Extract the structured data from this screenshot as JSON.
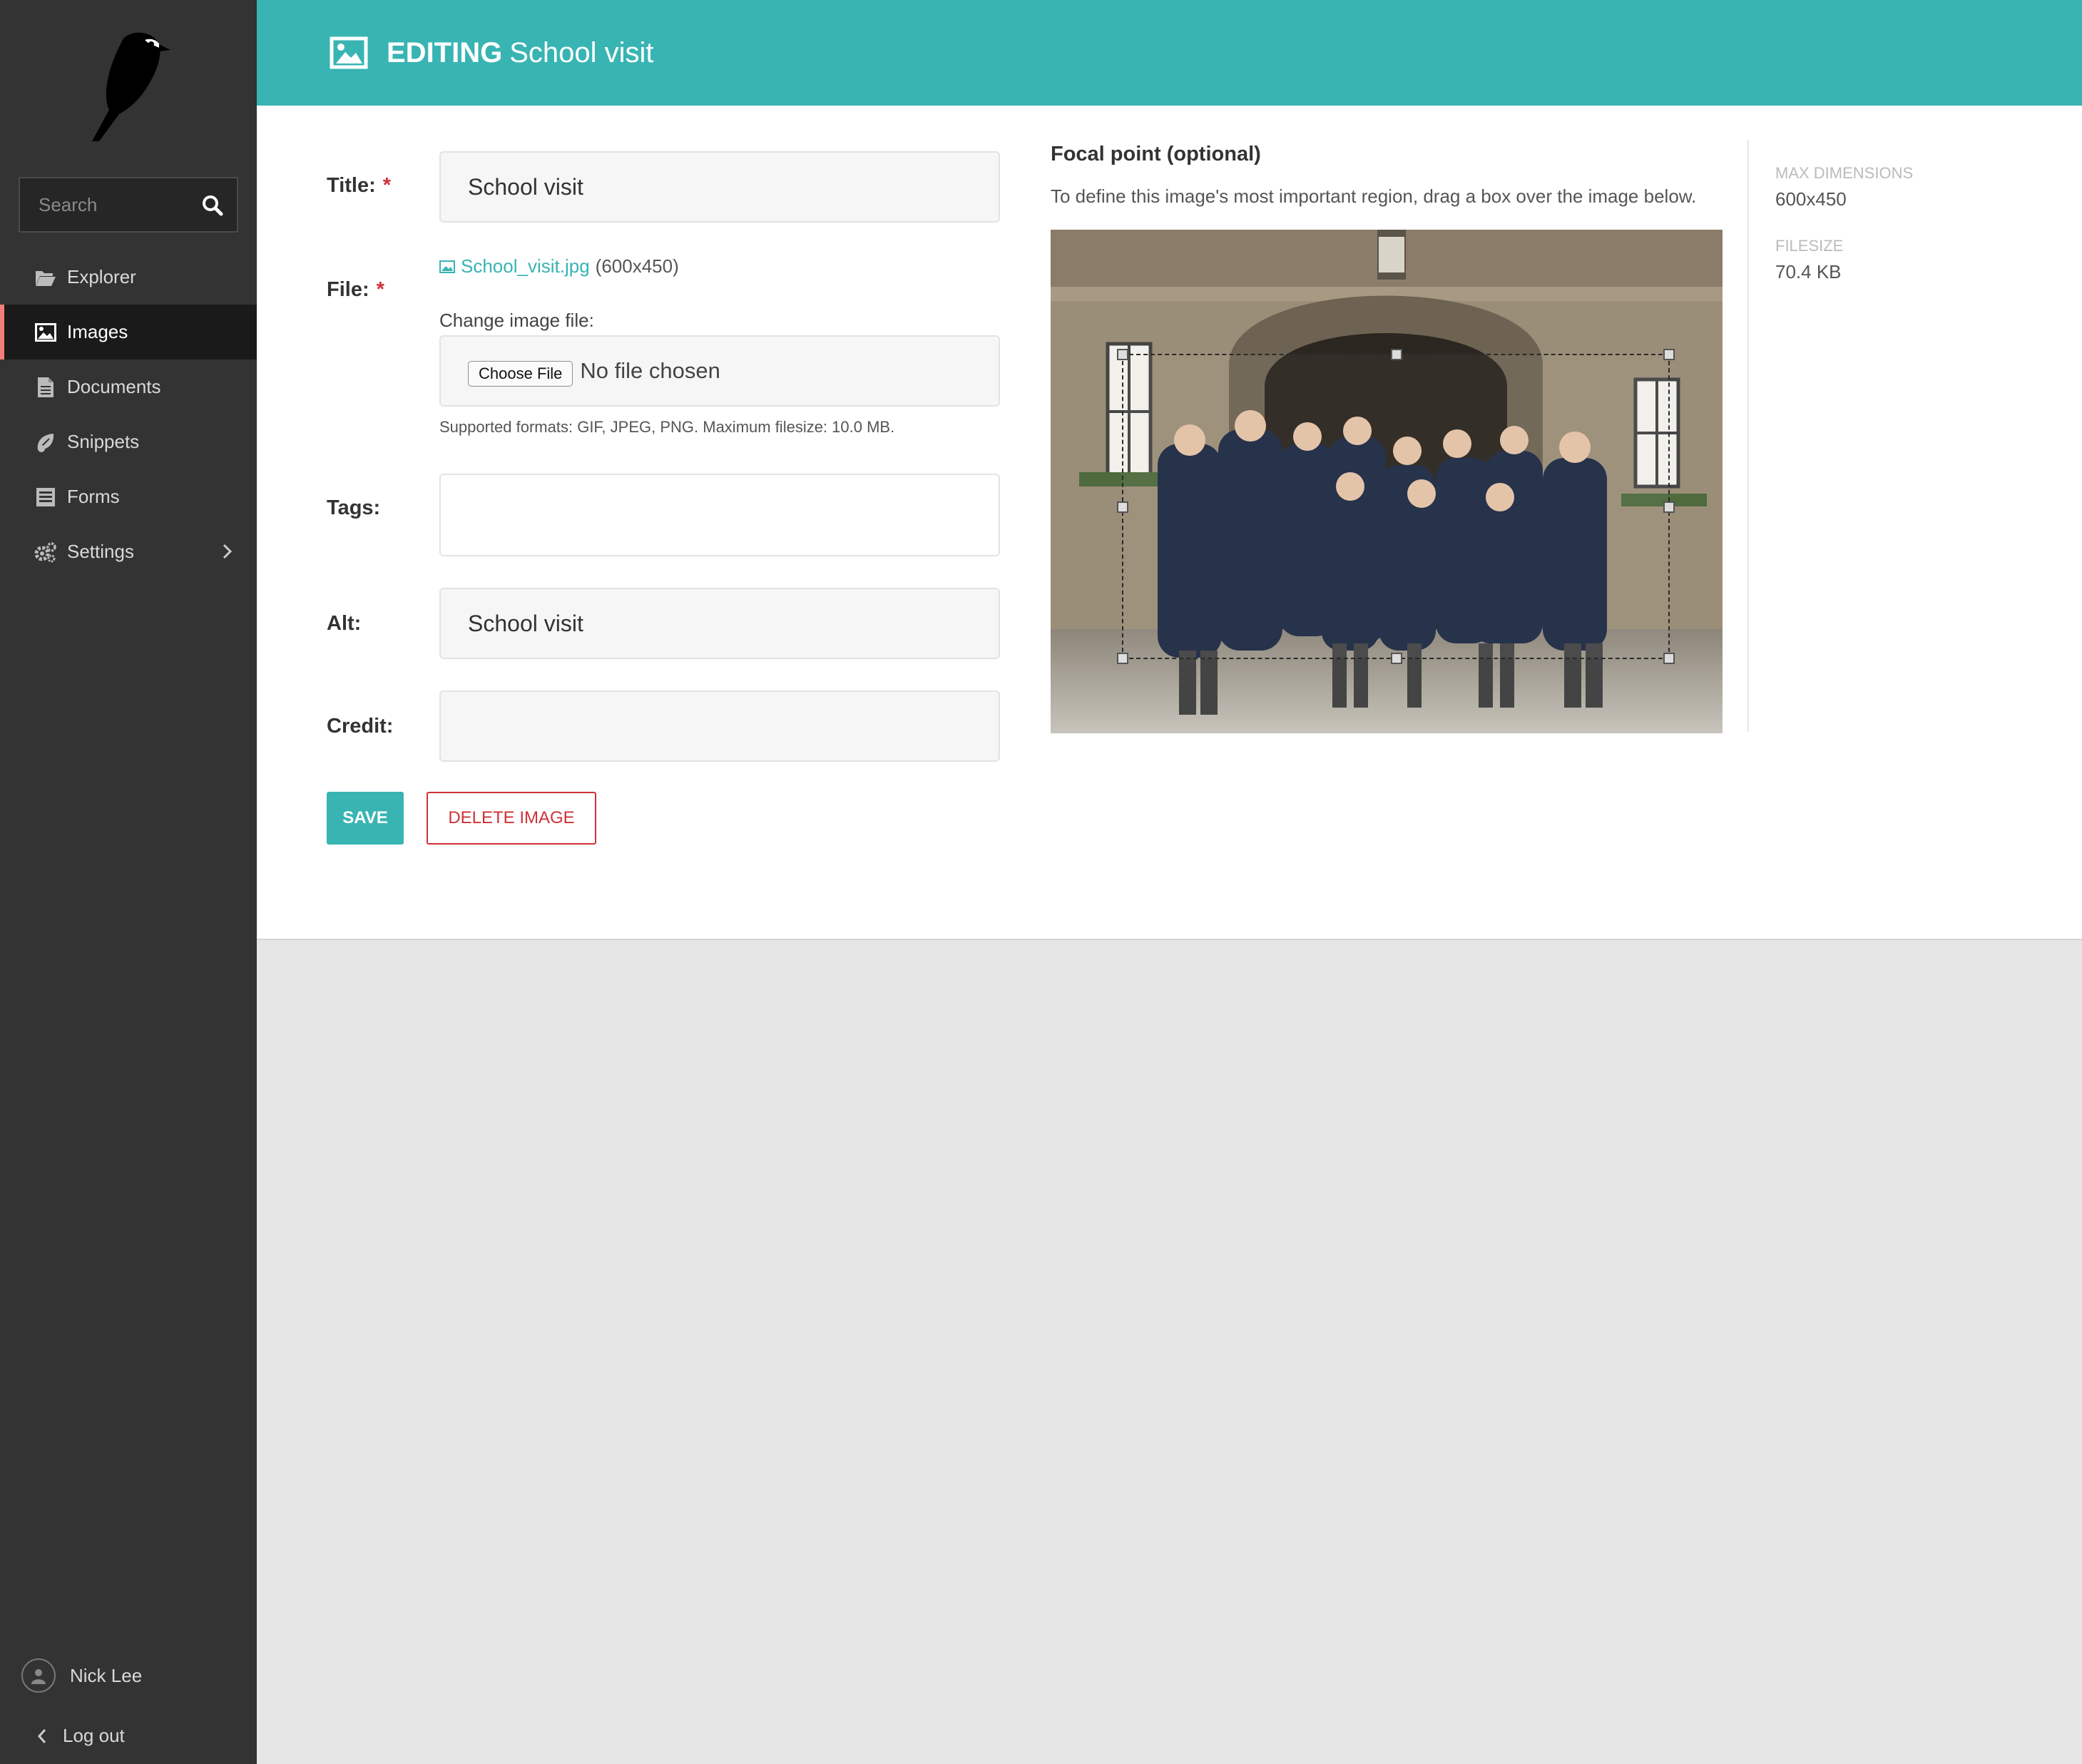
{
  "sidebar": {
    "search_placeholder": "Search",
    "items": [
      {
        "label": "Explorer",
        "icon": "folder-open-icon"
      },
      {
        "label": "Images",
        "icon": "image-icon"
      },
      {
        "label": "Documents",
        "icon": "document-icon"
      },
      {
        "label": "Snippets",
        "icon": "snippet-icon"
      },
      {
        "label": "Forms",
        "icon": "form-icon"
      },
      {
        "label": "Settings",
        "icon": "cogs-icon"
      }
    ],
    "active_item": "Images",
    "user_name": "Nick Lee",
    "logout_label": "Log out"
  },
  "header": {
    "action": "EDITING",
    "title": "School visit"
  },
  "form": {
    "title_label": "Title:",
    "title_value": "School visit",
    "file_label": "File:",
    "file_name": "School_visit.jpg",
    "file_dims": "(600x450)",
    "change_label": "Change image file:",
    "choose_button": "Choose File",
    "no_file": "No file chosen",
    "help_text": "Supported formats: GIF, JPEG, PNG. Maximum filesize: 10.0 MB.",
    "tags_label": "Tags:",
    "tags_value": "",
    "alt_label": "Alt:",
    "alt_value": "School visit",
    "credit_label": "Credit:",
    "credit_value": "",
    "required_mark": "*",
    "save_button": "SAVE",
    "delete_button": "DELETE IMAGE"
  },
  "focal": {
    "title": "Focal point (optional)",
    "description": "To define this image's most important region, drag a box over the image below."
  },
  "meta": {
    "max_dimensions_label": "MAX DIMENSIONS",
    "max_dimensions_value": "600x450",
    "filesize_label": "FILESIZE",
    "filesize_value": "70.4 KB"
  },
  "colors": {
    "accent": "#38b4b3",
    "sidebar_bg": "#333333",
    "active_marker": "#f37e77",
    "danger": "#cd3238"
  }
}
